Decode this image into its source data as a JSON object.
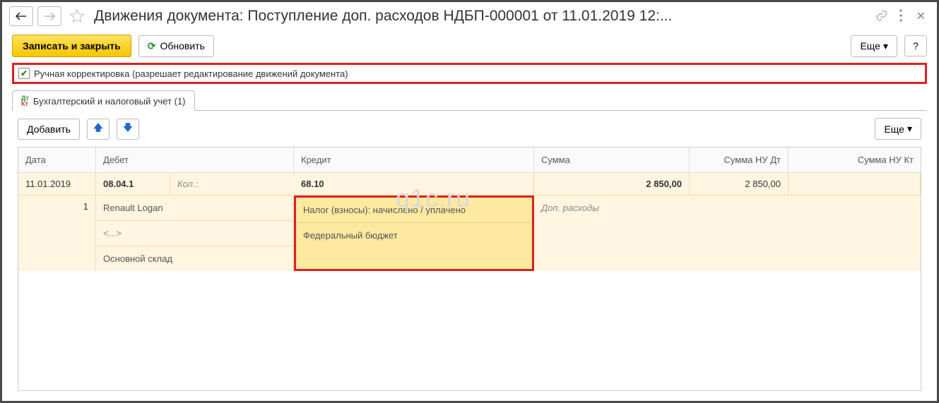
{
  "header": {
    "title": "Движения документа: Поступление доп. расходов НДБП-000001 от 11.01.2019 12:..."
  },
  "toolbar": {
    "save_close": "Записать и закрыть",
    "refresh": "Обновить",
    "more": "Еще",
    "help": "?"
  },
  "checkbox": {
    "checked": true,
    "label": "Ручная корректировка (разрешает редактирование движений документа)"
  },
  "tabs": [
    {
      "label": "Бухгалтерский и налоговый учет (1)"
    }
  ],
  "grid_toolbar": {
    "add": "Добавить",
    "more": "Еще"
  },
  "columns": {
    "date": "Дата",
    "debit": "Дебет",
    "credit": "Кредит",
    "sum": "Сумма",
    "sum_nu_dt": "Сумма НУ Дт",
    "sum_nu_kt": "Сумма НУ Кт"
  },
  "entries": [
    {
      "date": "11.01.2019",
      "row_num": "1",
      "debit_account": "08.04.1",
      "debit_qty_label": "Кол.:",
      "debit_subconto": [
        "Renault Logan",
        "<...>",
        "Основной склад"
      ],
      "credit_account": "68.10",
      "credit_subconto": [
        "Налог (взносы): начислено / уплачено",
        "Федеральный бюджет"
      ],
      "sum": "2 850,00",
      "sum_note": "Доп. расходы",
      "sum_nu_dt": "2 850,00",
      "sum_nu_kt": ""
    }
  ],
  "watermark": "q1c.ru"
}
